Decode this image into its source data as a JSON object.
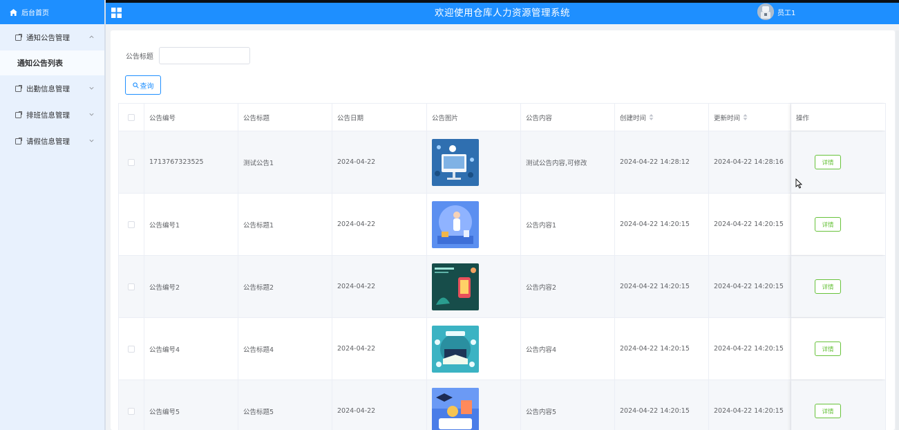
{
  "sidebar": {
    "brand": "后台首页",
    "menu": [
      {
        "label": "通知公告管理",
        "expanded": true
      },
      {
        "label": "出勤信息管理",
        "expanded": false
      },
      {
        "label": "排班信息管理",
        "expanded": false
      },
      {
        "label": "请假信息管理",
        "expanded": false
      }
    ],
    "submenu_active": "通知公告列表"
  },
  "header": {
    "title": "欢迎使用仓库人力资源管理系统",
    "user": "员工1"
  },
  "search": {
    "label": "公告标题",
    "value": "",
    "button": "查询"
  },
  "table": {
    "columns": [
      "公告编号",
      "公告标题",
      "公告日期",
      "公告图片",
      "公告内容",
      "创建时间",
      "更新时间",
      "操作"
    ],
    "detail_label": "详情",
    "rows": [
      {
        "no": "1713767323525",
        "title": "测试公告1",
        "date": "2024-04-22",
        "content": "测试公告内容,可修改",
        "created": "2024-04-22 14:28:12",
        "updated": "2024-04-22 14:28:16"
      },
      {
        "no": "公告编号1",
        "title": "公告标题1",
        "date": "2024-04-22",
        "content": "公告内容1",
        "created": "2024-04-22 14:20:15",
        "updated": "2024-04-22 14:20:15"
      },
      {
        "no": "公告编号2",
        "title": "公告标题2",
        "date": "2024-04-22",
        "content": "公告内容2",
        "created": "2024-04-22 14:20:15",
        "updated": "2024-04-22 14:20:15"
      },
      {
        "no": "公告编号4",
        "title": "公告标题4",
        "date": "2024-04-22",
        "content": "公告内容4",
        "created": "2024-04-22 14:20:15",
        "updated": "2024-04-22 14:20:15"
      },
      {
        "no": "公告编号5",
        "title": "公告标题5",
        "date": "2024-04-22",
        "content": "公告内容5",
        "created": "2024-04-22 14:20:15",
        "updated": "2024-04-22 14:20:15"
      }
    ]
  },
  "colors": {
    "primary": "#1e8fff",
    "sidebar_bg": "#e8f1fd",
    "detail_green": "#67c23a"
  }
}
